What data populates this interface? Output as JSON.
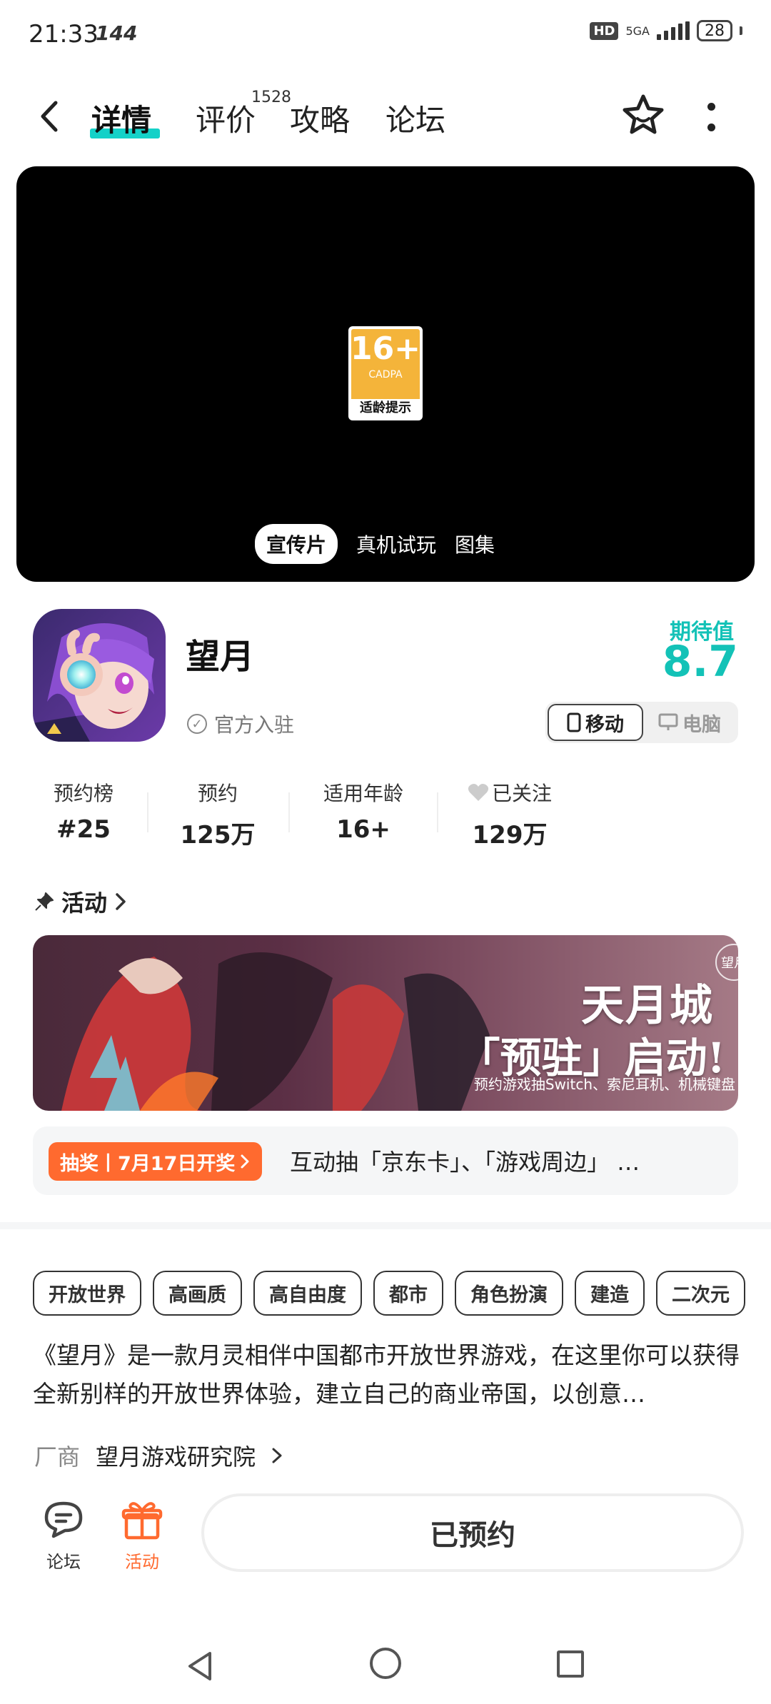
{
  "status": {
    "time": "21:33",
    "hz": "144",
    "network": "5GA",
    "hd": "HD",
    "battery": "28"
  },
  "nav": {
    "tabs": [
      {
        "label": "详情"
      },
      {
        "label": "评价"
      },
      {
        "label": "攻略"
      },
      {
        "label": "论坛"
      }
    ],
    "review_count": "1528"
  },
  "video": {
    "age_rating": "16+",
    "age_org": "CADPA",
    "age_hint": "适龄提示",
    "tabs": [
      "宣传片",
      "真机试玩",
      "图集"
    ]
  },
  "app": {
    "name": "望月",
    "official": "官方入驻",
    "expect_label": "期待值",
    "expect_value": "8.7",
    "platforms": [
      "移动",
      "电脑"
    ]
  },
  "stats": [
    {
      "label": "预约榜",
      "value": "#25"
    },
    {
      "label": "预约",
      "value": "125万"
    },
    {
      "label": "适用年龄",
      "value": "16+"
    },
    {
      "label": "已关注",
      "value": "129万"
    }
  ],
  "activity": {
    "header": "活动",
    "banner_title_1": "天月城",
    "banner_title_2": "「预驻」启动!",
    "banner_sub": "预约游戏抽Switch、索尼耳机、机械键盘",
    "banner_logo": "望月",
    "lottery_tag": "抽奖丨7月17日开奖",
    "lottery_text": "互动抽「京东卡」、「游戏周边」 …"
  },
  "tags": [
    "开放世界",
    "高画质",
    "高自由度",
    "都市",
    "角色扮演",
    "建造",
    "二次元"
  ],
  "description": "《望月》是一款月灵相伴中国都市开放世界游戏，在这里你可以获得全新别样的开放世界体验，建立自己的商业帝国，以创意…",
  "vendor": {
    "label": "厂商",
    "value": "望月游戏研究院"
  },
  "bottom": {
    "forum": "论坛",
    "activity": "活动",
    "reserve": "已预约"
  },
  "colors": {
    "accent": "#13c2b7",
    "orange": "#ff6a2f"
  }
}
